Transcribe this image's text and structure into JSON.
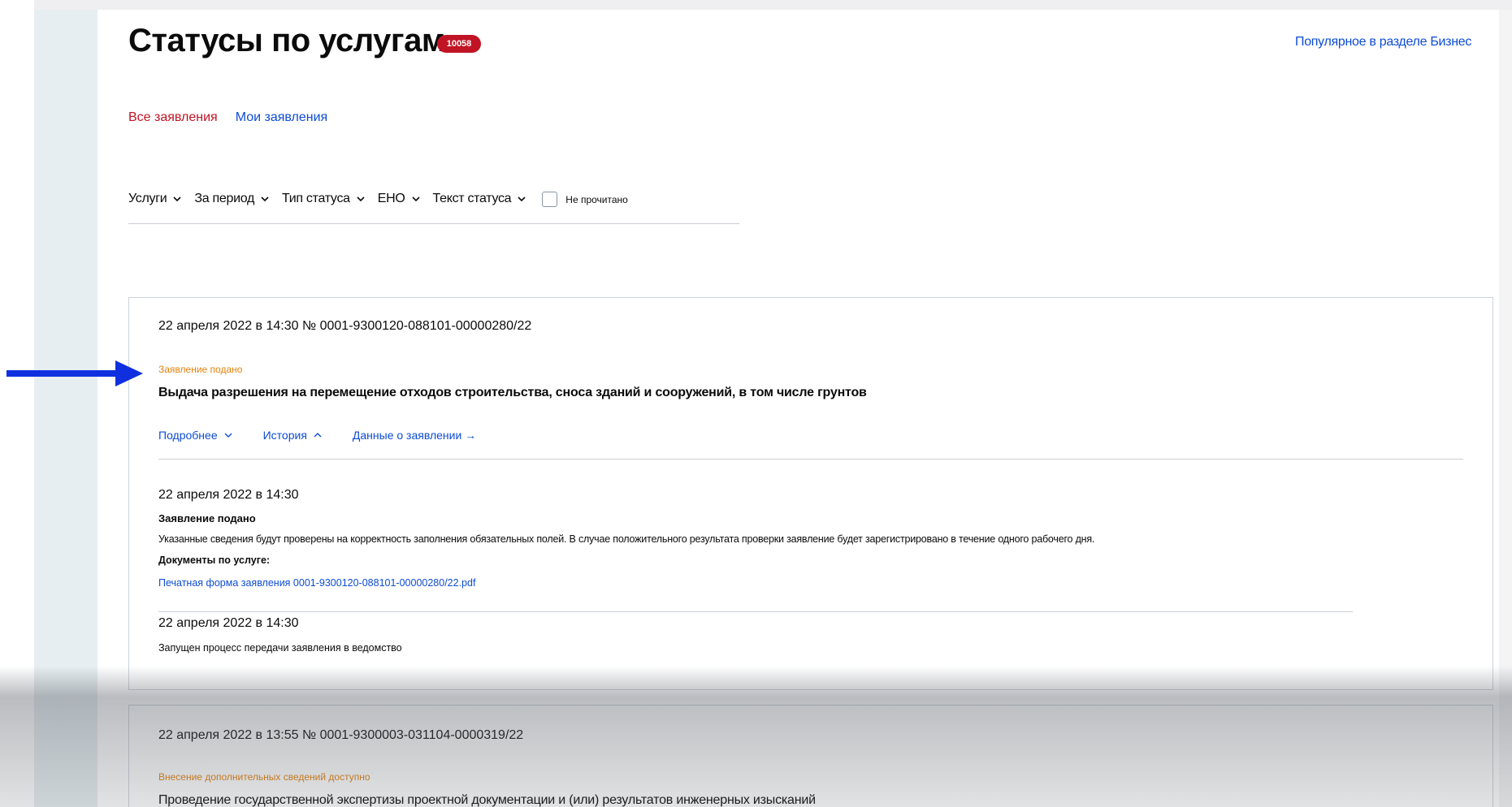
{
  "header": {
    "title": "Статусы по услугам",
    "badge": "10058",
    "popular_link": "Популярное в разделе Бизнес"
  },
  "tabs": [
    {
      "label": "Все заявления",
      "active": true
    },
    {
      "label": "Мои заявления",
      "active": false
    }
  ],
  "filters": {
    "services": "Услуги",
    "period": "За период",
    "status_type": "Тип статуса",
    "eno": "ЕНО",
    "status_text": "Текст статуса",
    "unread": "Не прочитано"
  },
  "cards": [
    {
      "header": "22 апреля 2022 в 14:30  № 0001-9300120-088101-00000280/22",
      "status": "Заявление подано",
      "title": "Выдача разрешения на перемещение отходов строительства, сноса зданий и сооружений, в том числе грунтов",
      "links": {
        "details": "Подробнее",
        "history": "История",
        "data": "Данные о заявлении →"
      },
      "history": [
        {
          "date": "22 апреля 2022 в 14:30",
          "title": "Заявление подано",
          "description": "Указанные сведения будут проверены на корректность заполнения обязательных полей. В случае положительного результата проверки заявление будет зарегистрировано в течение одного рабочего дня.",
          "docs_label": "Документы по услуге:",
          "file": "Печатная форма заявления 0001-9300120-088101-00000280/22.pdf"
        },
        {
          "date": "22 апреля 2022 в 14:30",
          "title": "Запущен процесс передачи заявления в ведомство"
        }
      ]
    },
    {
      "header": "22 апреля 2022 в 13:55  № 0001-9300003-031104-0000319/22",
      "status": "Внесение дополнительных сведений доступно",
      "title": "Проведение государственной экспертизы проектной документации и (или) результатов инженерных изысканий"
    }
  ],
  "colors": {
    "accent_blue": "#0d4cd3",
    "active_red": "#c01424",
    "status_orange": "#e5810c",
    "arrow_blue": "#1030e0"
  }
}
